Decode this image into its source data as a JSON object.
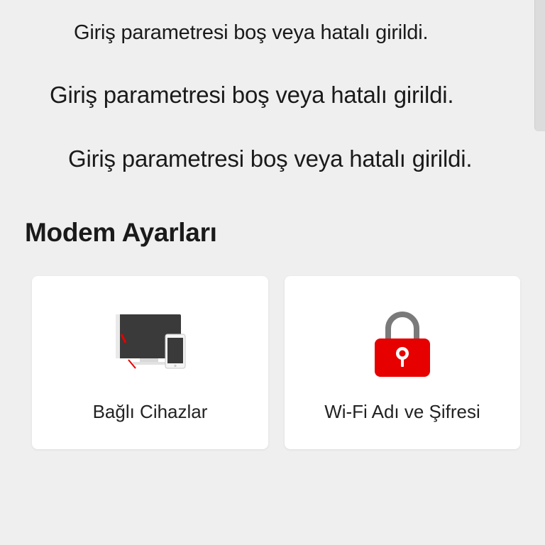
{
  "errors": [
    "Giriş parametresi boş veya hatalı girildi.",
    "Giriş parametresi boş veya hatalı girildi.",
    "Giriş parametresi boş veya hatalı girildi."
  ],
  "section": {
    "title": "Modem Ayarları"
  },
  "cards": [
    {
      "label": "Bağlı Cihazlar",
      "icon": "connected-devices-icon"
    },
    {
      "label": "Wi-Fi Adı ve Şifresi",
      "icon": "padlock-icon"
    }
  ],
  "colors": {
    "background": "#efefef",
    "card": "#ffffff",
    "accent": "#e60000",
    "screen": "#3a3a3a"
  }
}
